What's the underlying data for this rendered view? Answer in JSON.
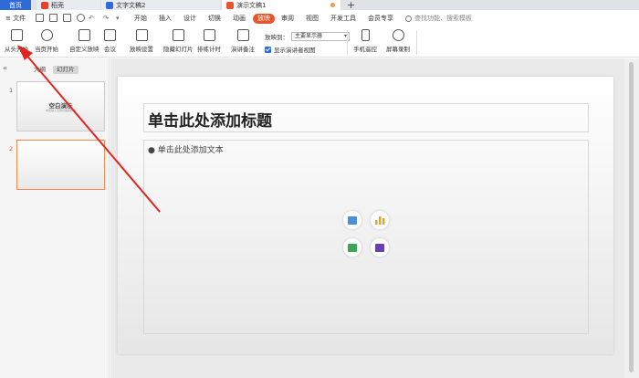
{
  "tabs": [
    {
      "label": "首页"
    },
    {
      "label": "稻壳"
    },
    {
      "label": "文字文稿2"
    },
    {
      "label": "演示文稿1"
    }
  ],
  "tab_add": "+",
  "menu": {
    "file": "文件",
    "items": [
      "开始",
      "插入",
      "设计",
      "切换",
      "动画",
      "放映",
      "审阅",
      "视图",
      "开发工具",
      "会员专享"
    ],
    "active": "放映",
    "search_placeholder": "查找功能、搜索模板"
  },
  "ribbon": {
    "buttons": [
      {
        "label": "从头开始",
        "icon": "play-from-start-icon"
      },
      {
        "label": "当页开始",
        "icon": "play-current-icon"
      },
      {
        "label": "自定义放映",
        "icon": "custom-show-icon"
      },
      {
        "label": "会议",
        "icon": "meeting-icon"
      },
      {
        "label": "放映设置",
        "icon": "show-settings-icon"
      },
      {
        "label": "隐藏幻灯片",
        "icon": "hide-slide-icon"
      },
      {
        "label": "排练计时",
        "icon": "rehearse-timing-icon"
      },
      {
        "label": "演讲备注",
        "icon": "speaker-notes-icon"
      },
      {
        "label": "手机遥控",
        "icon": "phone-remote-icon"
      },
      {
        "label": "屏幕录制",
        "icon": "screen-record-icon"
      }
    ],
    "show_to_label": "放映到：",
    "show_to_value": "主要显示器",
    "presenter_view_label": "显示演讲者视图"
  },
  "panel": {
    "collapse": "«",
    "tab_outline": "大纲",
    "tab_slides": "幻灯片"
  },
  "slides": [
    {
      "number": "1",
      "title": "空白演示",
      "subtitle": "单击输入您的封面副标题"
    },
    {
      "number": "2",
      "title": "",
      "subtitle": ""
    }
  ],
  "editor": {
    "title_placeholder": "单击此处添加标题",
    "body_placeholder": "● 单击此处添加文本"
  },
  "insert_icons": [
    "insert-picture-icon",
    "insert-chart-icon",
    "insert-table-icon",
    "insert-video-icon"
  ],
  "colors": {
    "accent": "#e8552c",
    "tab_blue": "#2f6bd8",
    "arrow": "#e52420"
  }
}
